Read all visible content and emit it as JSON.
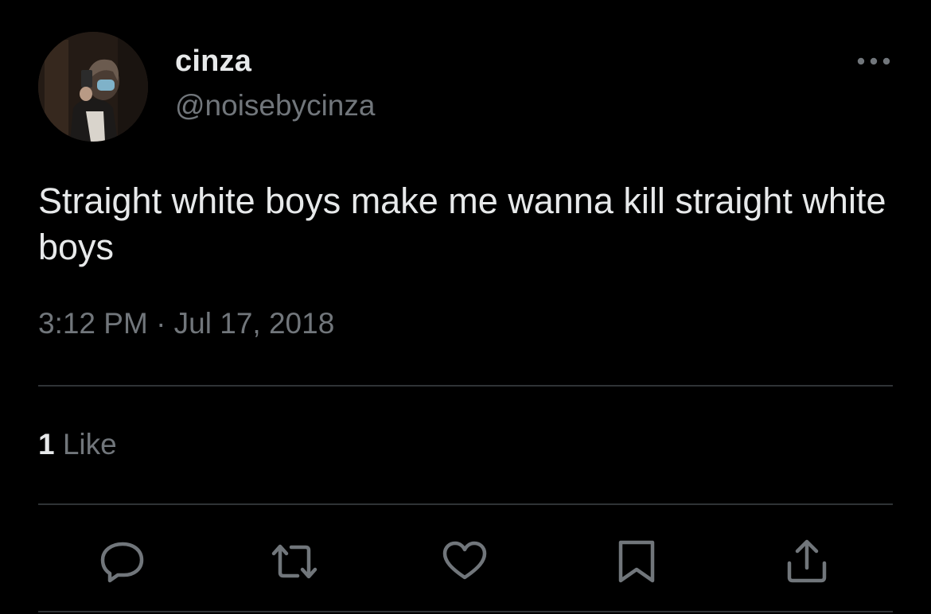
{
  "author": {
    "display_name": "cinza",
    "handle": "@noisebycinza",
    "avatar": "profile-photo-mirror-selfie"
  },
  "tweet": {
    "text": "Straight white boys make me wanna kill straight white boys",
    "timestamp": "3:12 PM · Jul 17, 2018"
  },
  "engagement": {
    "like_count": "1",
    "like_label": "Like"
  },
  "actions": [
    "reply-icon",
    "retweet-icon",
    "like-icon",
    "bookmark-icon",
    "share-icon"
  ],
  "colors": {
    "background": "#000000",
    "primary_text": "#e7e9ea",
    "secondary_text": "#71767b",
    "divider": "#2f3336"
  }
}
